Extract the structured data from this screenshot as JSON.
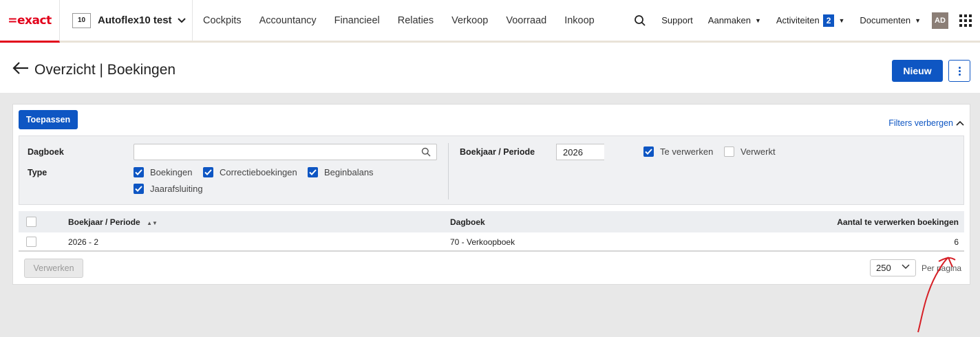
{
  "nav": {
    "logo": "=exact",
    "company_code": "10",
    "company_name": "Autoflex10 test",
    "menu": [
      "Cockpits",
      "Accountancy",
      "Financieel",
      "Relaties",
      "Verkoop",
      "Voorraad",
      "Inkoop"
    ],
    "support": "Support",
    "create": "Aanmaken",
    "activities": "Activiteiten",
    "activities_count": "2",
    "documents": "Documenten",
    "user_initials": "AD"
  },
  "page": {
    "title": "Overzicht | Boekingen",
    "new_label": "Nieuw"
  },
  "filters": {
    "apply_label": "Toepassen",
    "toggle_label": "Filters verbergen",
    "journal_label": "Dagboek",
    "journal_value": "",
    "type_label": "Type",
    "types": [
      {
        "label": "Boekingen",
        "checked": true
      },
      {
        "label": "Correctieboekingen",
        "checked": true
      },
      {
        "label": "Beginbalans",
        "checked": true
      },
      {
        "label": "Jaarafsluiting",
        "checked": true
      }
    ],
    "year_period_label": "Boekjaar / Periode",
    "year_value": "2026",
    "status": [
      {
        "label": "Te verwerken",
        "checked": true
      },
      {
        "label": "Verwerkt",
        "checked": false
      }
    ]
  },
  "table": {
    "columns": [
      "Boekjaar / Periode",
      "Dagboek",
      "Aantal te verwerken boekingen"
    ],
    "rows": [
      {
        "period": "2026 - 2",
        "journal": "70 - Verkoopboek",
        "count": "6"
      }
    ],
    "process_label": "Verwerken",
    "page_size": "250",
    "per_page_label": "Per pagina"
  },
  "colors": {
    "primary": "#0e56c3",
    "brand": "#e2001a",
    "annotation": "#d61f26"
  }
}
